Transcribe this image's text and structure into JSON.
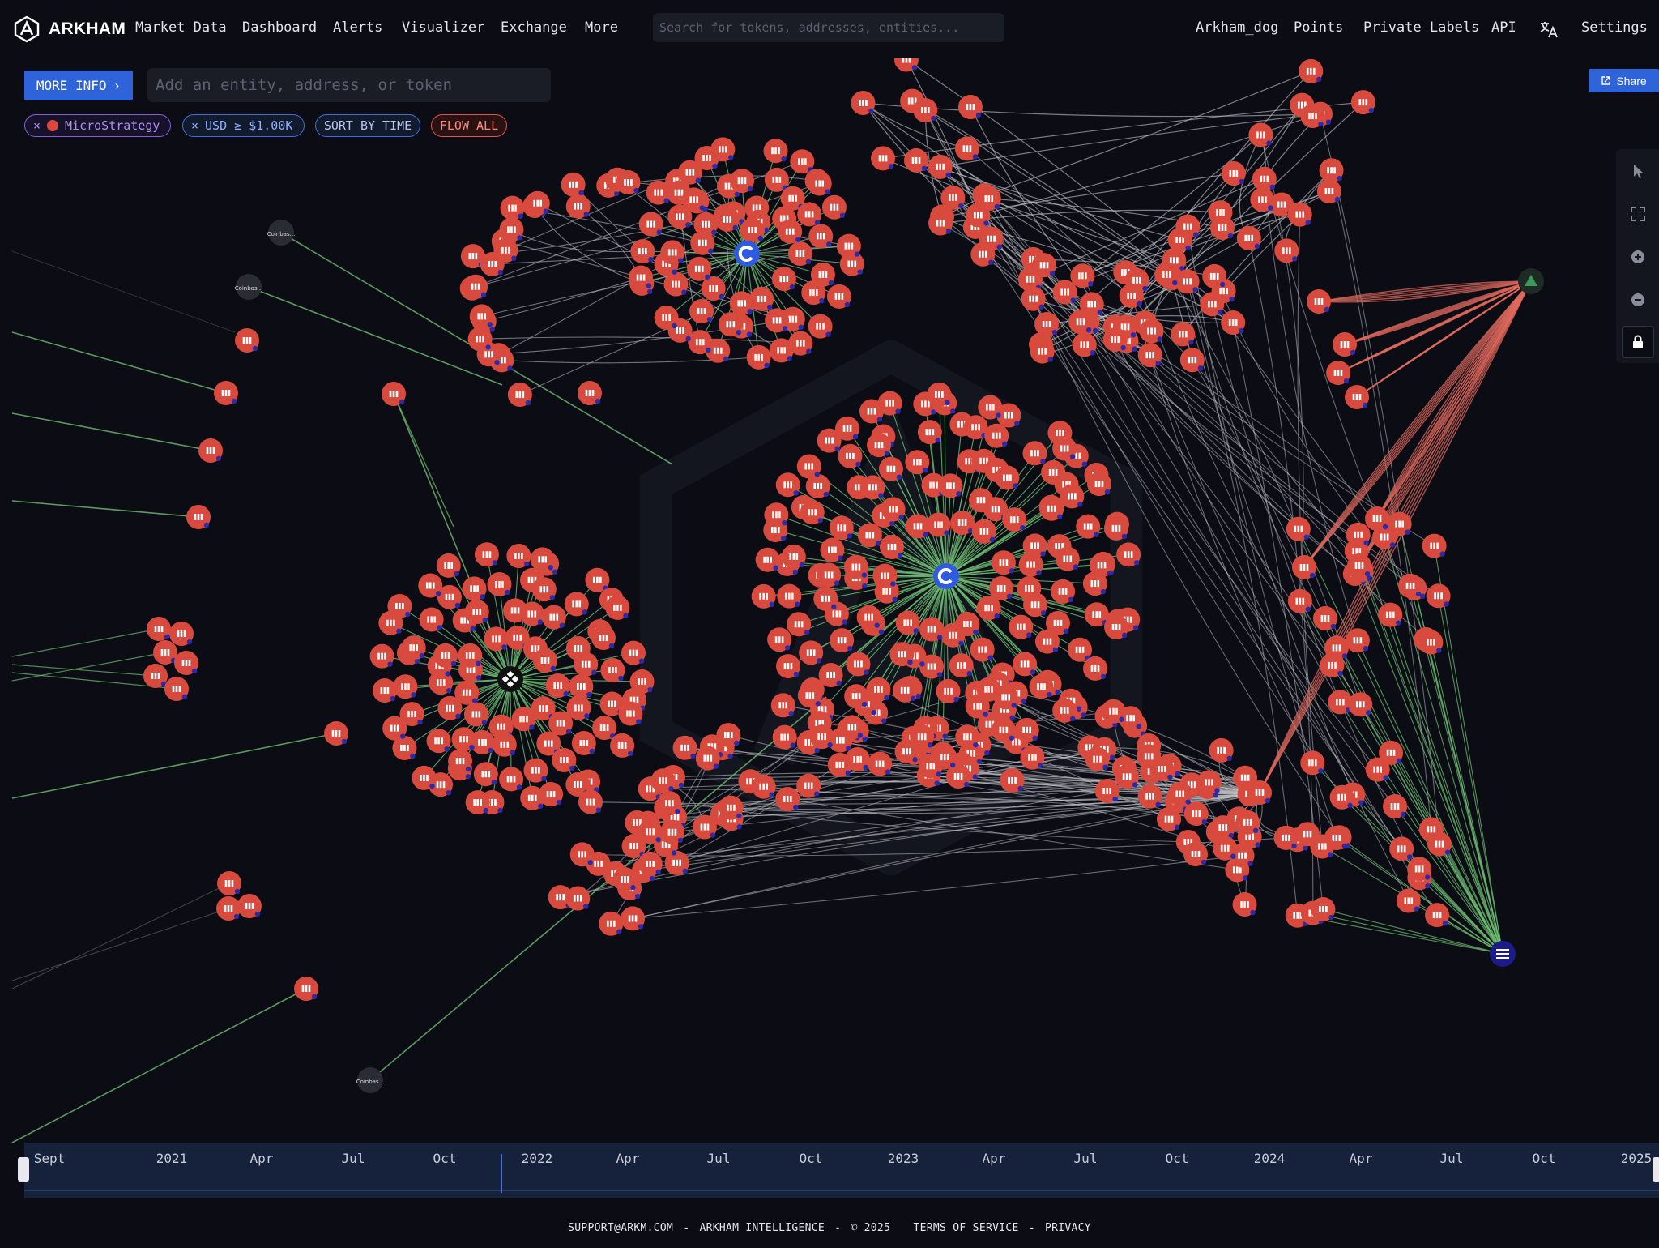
{
  "brand": {
    "name": "ARKHAM"
  },
  "nav": {
    "left": [
      "Market Data",
      "Dashboard",
      "Alerts",
      "Visualizer",
      "Exchange",
      "More"
    ],
    "search_placeholder": "Search for tokens, addresses, entities...",
    "right": [
      "Arkham_dog",
      "Points",
      "Private Labels",
      "API",
      "Settings"
    ],
    "translate_icon": "translate-icon"
  },
  "toolbar": {
    "more_info_label": "MORE INFO",
    "entity_placeholder": "Add an entity, address, or token",
    "share_label": "Share",
    "filters": {
      "entity": "MicroStrategy",
      "usd": "USD ≥ $1.00K",
      "sort": "SORT BY TIME",
      "flow": "FLOW ALL"
    }
  },
  "graph": {
    "small_labels": [
      "Coinbas...",
      "Coinbas...",
      "Coinbas..."
    ],
    "colors": {
      "node": "#d84a3d",
      "inflow": "#6fbf73",
      "outflow": "#e06a5d",
      "intra": "#c8c8cc",
      "background": "#0b0c14"
    },
    "hub_icons": [
      "coinbase-icon",
      "coinbase-icon",
      "binance-icon",
      "arkham-icon",
      "ethena-icon"
    ]
  },
  "timeline": {
    "labels": [
      "Sept",
      "2021",
      "Apr",
      "Jul",
      "Oct",
      "2022",
      "Apr",
      "Jul",
      "Oct",
      "2023",
      "Apr",
      "Jul",
      "Oct",
      "2024",
      "Apr",
      "Jul",
      "Oct",
      "2025"
    ]
  },
  "footer": {
    "support": "SUPPORT@ARKM.COM",
    "separator": "-",
    "company": "ARKHAM INTELLIGENCE",
    "copyright": "© 2025",
    "terms": "TERMS OF SERVICE",
    "privacy": "PRIVACY"
  }
}
